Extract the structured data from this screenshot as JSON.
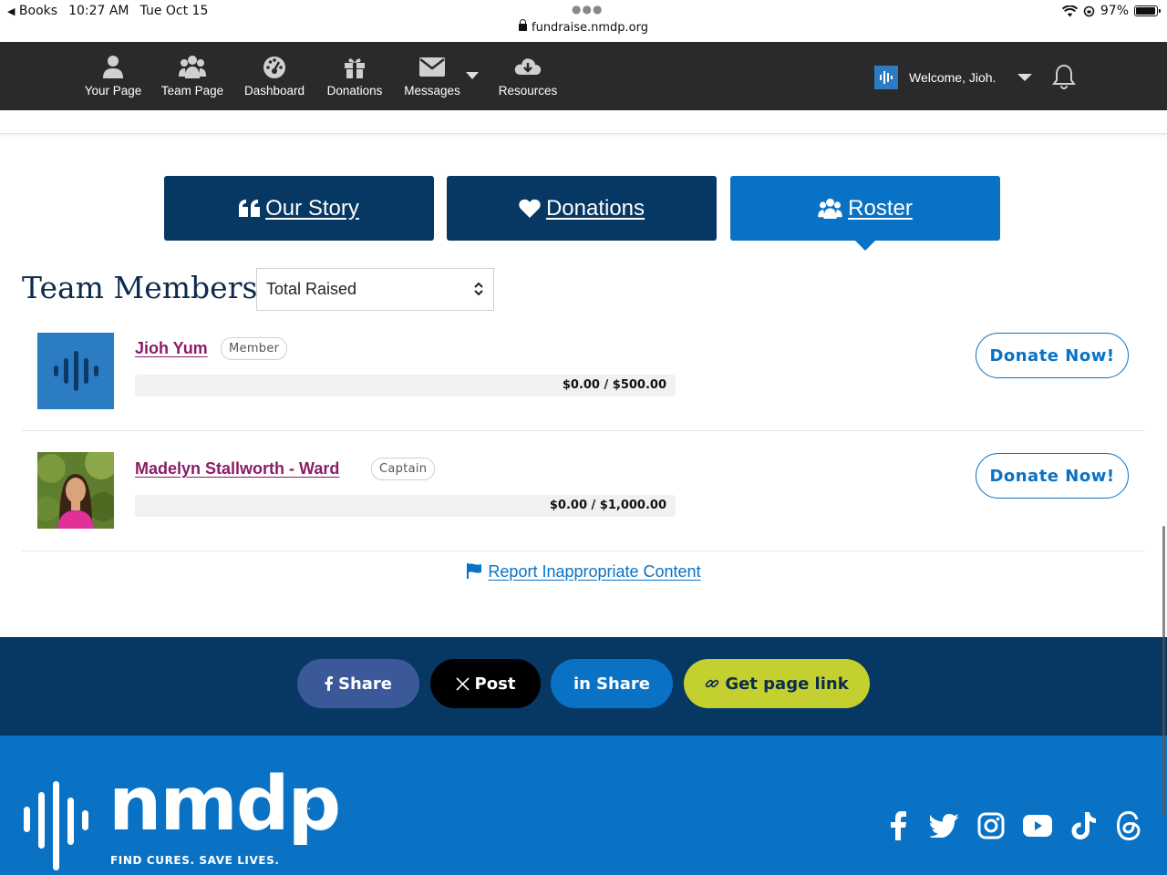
{
  "status_bar": {
    "back_app": "Books",
    "time": "10:27 AM",
    "date": "Tue Oct 15",
    "url": "fundraise.nmdp.org",
    "battery": "97%"
  },
  "nav": {
    "items": [
      {
        "label": "Your Page",
        "icon": "user-icon"
      },
      {
        "label": "Team Page",
        "icon": "users-icon"
      },
      {
        "label": "Dashboard",
        "icon": "dashboard-icon"
      },
      {
        "label": "Donations",
        "icon": "gift-icon"
      },
      {
        "label": "Messages",
        "icon": "envelope-icon"
      },
      {
        "label": "Resources",
        "icon": "cloud-download-icon"
      }
    ],
    "welcome": "Welcome, Jioh."
  },
  "tabs": [
    {
      "label": "Our Story",
      "icon": "quote-icon",
      "active": false
    },
    {
      "label": "Donations",
      "icon": "heart-icon",
      "active": false
    },
    {
      "label": "Roster",
      "icon": "users-icon",
      "active": true
    }
  ],
  "team": {
    "title": "Team Members",
    "sort_value": "Total Raised",
    "members": [
      {
        "name": "Jioh Yum",
        "role": "Member",
        "progress_text": "$0.00 / $500.00",
        "raised": 0,
        "goal": 500,
        "donate_label": "Donate Now!"
      },
      {
        "name": "Madelyn Stallworth - Ward",
        "role": "Captain",
        "progress_text": "$0.00 / $1,000.00",
        "raised": 0,
        "goal": 1000,
        "donate_label": "Donate Now!"
      }
    ],
    "report_label": "Report Inappropriate Content"
  },
  "share": {
    "facebook": {
      "label": "Share",
      "color": "#3b5998"
    },
    "x": {
      "label": "Post",
      "color": "#000000"
    },
    "linkedin": {
      "label": "Share",
      "color": "#0a72c4"
    },
    "link": {
      "label": "Get page link",
      "color": "#c3d02f"
    }
  },
  "footer": {
    "brand": "nmdp",
    "tagline": "FIND CURES. SAVE LIVES.",
    "social": [
      "facebook-icon",
      "twitter-icon",
      "instagram-icon",
      "youtube-icon",
      "tiktok-icon",
      "threads-icon"
    ]
  },
  "colors": {
    "navy": "#073763",
    "blue": "#0a72c4",
    "nav_bg": "#2a2a2a",
    "member_name": "#8b1c67",
    "lime": "#c3d02f"
  }
}
